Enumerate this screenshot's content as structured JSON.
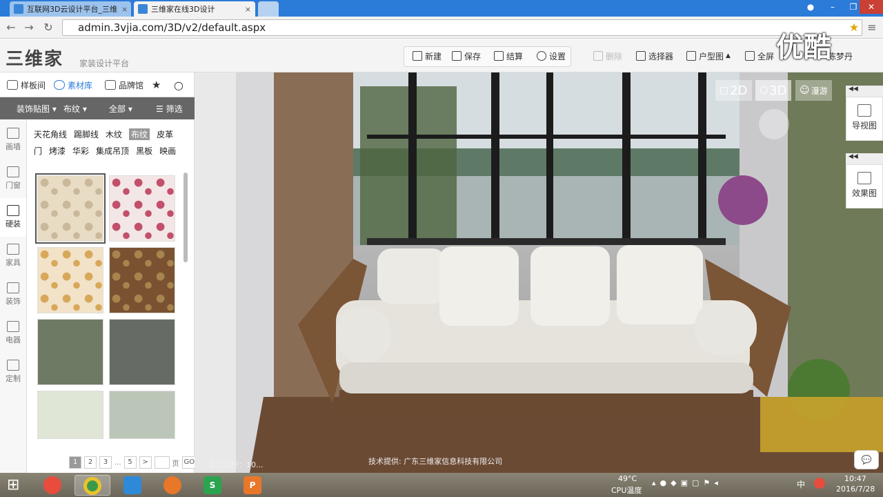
{
  "browser": {
    "tabs": [
      {
        "title": "互联网3D云设计平台_三维"
      },
      {
        "title": "三维家在线3D设计"
      }
    ],
    "url": "admin.3vjia.com/3D/v2/default.aspx"
  },
  "app": {
    "logo": "三维家",
    "subtitle": "家装设计平台",
    "toolbar": {
      "new": "新建",
      "save": "保存",
      "checkout": "结算",
      "settings": "设置",
      "delete": "删除",
      "selector": "选择器",
      "floorplan": "户型图",
      "fullscreen": "全屏",
      "user": "陈梦丹"
    },
    "watermark": "优酷"
  },
  "left": {
    "tabs": {
      "samples": "样板间",
      "materials": "素材库",
      "brands": "品牌馆"
    },
    "filters": {
      "category": "装饰贴图",
      "type": "布纹",
      "all": "全部",
      "filter": "筛选"
    },
    "side_categories": [
      "画墙",
      "门窗",
      "硬装",
      "家具",
      "装饰",
      "电器",
      "定制"
    ],
    "tags_row1": [
      "天花角线",
      "踢脚线",
      "木纹",
      "布纹",
      "皮革"
    ],
    "tags_row2": [
      "门",
      "烤漆",
      "华彩",
      "集成吊顶",
      "黑板",
      "映画"
    ],
    "thumbs": [
      {
        "color": "#e8dcc4",
        "pattern": "#c9b89a"
      },
      {
        "color": "#f3e6e6",
        "pattern": "#c2506a"
      },
      {
        "color": "#f1e2c8",
        "pattern": "#d8a85a"
      },
      {
        "color": "#7a5232",
        "pattern": "#a8844e"
      },
      {
        "color": "#6e7a63",
        "pattern": "#6e7a63"
      },
      {
        "color": "#666b66",
        "pattern": "#666b66"
      },
      {
        "color": "#dfe6d5",
        "pattern": "#dfe6d5"
      },
      {
        "color": "#bcc6b8",
        "pattern": "#bcc6b8"
      }
    ],
    "pager": {
      "pages": [
        "1",
        "2",
        "3",
        "...",
        "5"
      ],
      "next": ">",
      "go_label": "页",
      "go": "GO"
    }
  },
  "viewport": {
    "mode_2d": "2D",
    "mode_3d": "3D",
    "mode_walk": "漫游",
    "nav_map": "导视图",
    "render": "效果图",
    "credit": "技术提供: 广东三维家信息科技有限公司",
    "area": "套内面积：10..."
  },
  "taskbar": {
    "temp": "49°C",
    "temp_label": "CPU温度",
    "ime": "中",
    "time": "10:47",
    "date": "2016/7/28"
  }
}
